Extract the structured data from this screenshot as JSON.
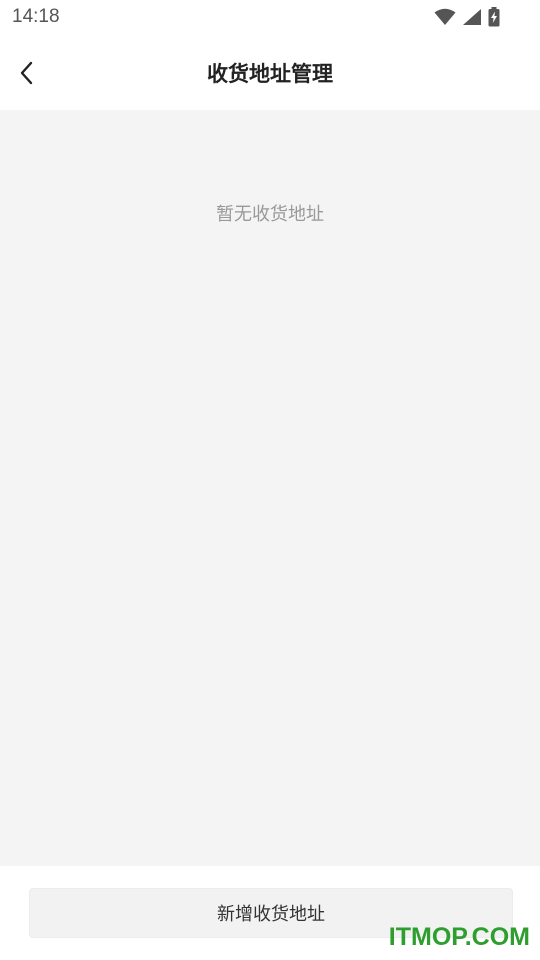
{
  "status_bar": {
    "time": "14:18",
    "icons": [
      "wifi-icon",
      "signal-icon",
      "battery-charging-icon"
    ]
  },
  "nav": {
    "back_icon": "chevron-left-icon",
    "title": "收货地址管理"
  },
  "content": {
    "empty_message": "暂无收货地址"
  },
  "bottom": {
    "add_button_label": "新增收货地址"
  },
  "watermark": {
    "text": "ITMOP.COM"
  },
  "colors": {
    "background": "#f4f4f4",
    "surface": "#ffffff",
    "button_bg": "#f2f2f2",
    "empty_text": "#999999",
    "watermark": "#2e9e2e"
  }
}
